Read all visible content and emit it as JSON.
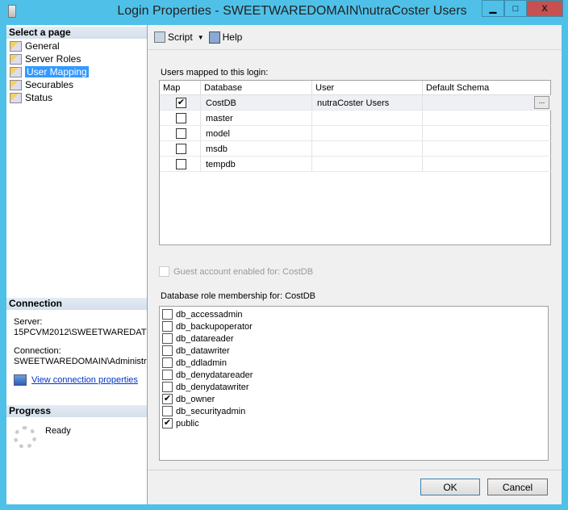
{
  "window": {
    "title": "Login Properties - SWEETWAREDOMAIN\\nutraCoster Users",
    "minimize": "▁",
    "maximize": "□",
    "close": "X"
  },
  "sidebar": {
    "select_header": "Select a page",
    "items": [
      {
        "label": "General"
      },
      {
        "label": "Server Roles"
      },
      {
        "label": "User Mapping"
      },
      {
        "label": "Securables"
      },
      {
        "label": "Status"
      }
    ],
    "connection_header": "Connection",
    "server_label": "Server:",
    "server_value": "15PCVM2012\\SWEETWAREDAT",
    "connection_label": "Connection:",
    "connection_value": "SWEETWAREDOMAIN\\Administr",
    "view_link": "View connection properties",
    "progress_header": "Progress",
    "progress_status": "Ready"
  },
  "toolbar": {
    "script": "Script",
    "help": "Help"
  },
  "users": {
    "label": "Users mapped to this login:",
    "columns": [
      "Map",
      "Database",
      "User",
      "Default Schema"
    ],
    "rows": [
      {
        "checked": true,
        "database": "CostDB",
        "user": "nutraCoster Users",
        "schema": ""
      },
      {
        "checked": false,
        "database": "master",
        "user": "",
        "schema": ""
      },
      {
        "checked": false,
        "database": "model",
        "user": "",
        "schema": ""
      },
      {
        "checked": false,
        "database": "msdb",
        "user": "",
        "schema": ""
      },
      {
        "checked": false,
        "database": "tempdb",
        "user": "",
        "schema": ""
      }
    ],
    "ellipsis": "..."
  },
  "guest": {
    "label": "Guest account enabled for: CostDB",
    "checked": false
  },
  "roles": {
    "label": "Database role membership for: CostDB",
    "items": [
      {
        "name": "db_accessadmin",
        "checked": false
      },
      {
        "name": "db_backupoperator",
        "checked": false
      },
      {
        "name": "db_datareader",
        "checked": false
      },
      {
        "name": "db_datawriter",
        "checked": false
      },
      {
        "name": "db_ddladmin",
        "checked": false
      },
      {
        "name": "db_denydatareader",
        "checked": false
      },
      {
        "name": "db_denydatawriter",
        "checked": false
      },
      {
        "name": "db_owner",
        "checked": true
      },
      {
        "name": "db_securityadmin",
        "checked": false
      },
      {
        "name": "public",
        "checked": true
      }
    ]
  },
  "buttons": {
    "ok": "OK",
    "cancel": "Cancel"
  }
}
